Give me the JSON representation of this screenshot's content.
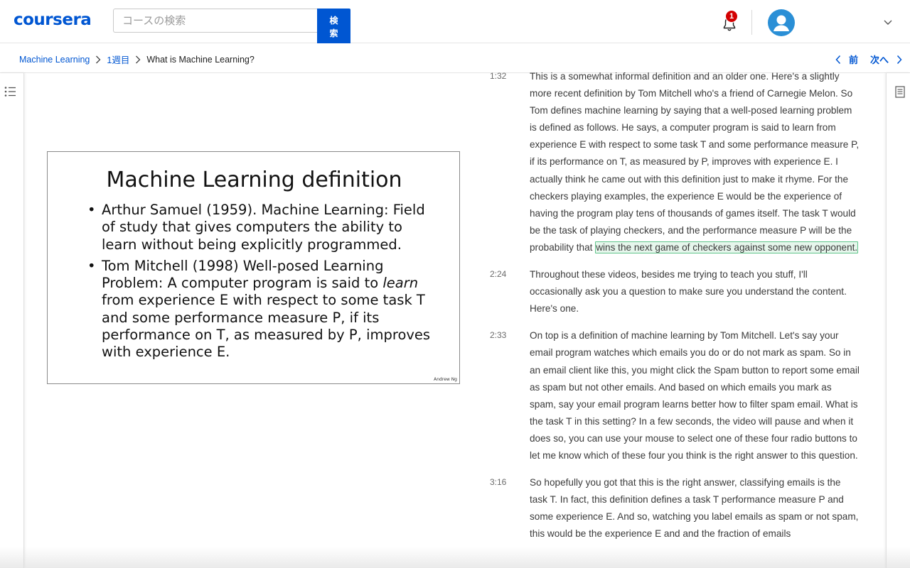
{
  "header": {
    "logo": "coursera",
    "search_placeholder": "コースの検索",
    "search_button": "検索",
    "notification_count": "1"
  },
  "breadcrumb": {
    "course": "Machine Learning",
    "week": "1週目",
    "lesson": "What is Machine Learning?"
  },
  "nav": {
    "prev": "前",
    "next": "次へ"
  },
  "slide": {
    "title": "Machine Learning definition",
    "bullet1": "Arthur Samuel (1959). Machine Learning: Field of study that gives computers the ability to learn without being explicitly programmed.",
    "bullet2_part1": "Tom Mitchell (1998) Well-posed Learning Problem: A computer program is said to ",
    "bullet2_italic": "learn",
    "bullet2_part2": " from experience E with respect to some task T and some performance measure P, if its performance on T, as measured by P, improves with experience E.",
    "signature": "Andrew Ng"
  },
  "transcript": [
    {
      "time": "1:32",
      "text": "This is a somewhat informal definition and an older one. Here's a slightly more recent definition by Tom Mitchell who's a friend of Carnegie Melon. So Tom defines machine learning by saying that a well-posed learning problem is defined as follows. He says, a computer program is said to learn from experience E with respect to some task T and some performance measure P, if its performance on T, as measured by P, improves with experience E. I actually think he came out with this definition just to make it rhyme. For the checkers playing examples, the experience E would be the experience of having the program play tens of thousands of games itself. The task T would be the task of playing checkers, and the performance measure P will be the probability that ",
      "highlight": "wins the next game of checkers against some new opponent."
    },
    {
      "time": "2:24",
      "text": "Throughout these videos, besides me trying to teach you stuff, I'll occasionally ask you a question to make sure you understand the content. Here's one."
    },
    {
      "time": "2:33",
      "text": "On top is a definition of machine learning by Tom Mitchell. Let's say your email program watches which emails you do or do not mark as spam. So in an email client like this, you might click the Spam button to report some email as spam but not other emails. And based on which emails you mark as spam, say your email program learns better how to filter spam email. What is the task T in this setting? In a few seconds, the video will pause and when it does so, you can use your mouse to select one of these four radio buttons to let me know which of these four you think is the right answer to this question."
    },
    {
      "time": "3:16",
      "text": "So hopefully you got that this is the right answer, classifying emails is the task T. In fact, this definition defines a task T performance measure P and some experience E. And so, watching you label emails as spam or not spam, this would be the experience E and and the fraction of emails"
    }
  ],
  "colors": {
    "brand": "#0056d2",
    "badge": "#d30001",
    "highlight_bg": "#e6f6ec",
    "highlight_border": "#5fc48a"
  }
}
